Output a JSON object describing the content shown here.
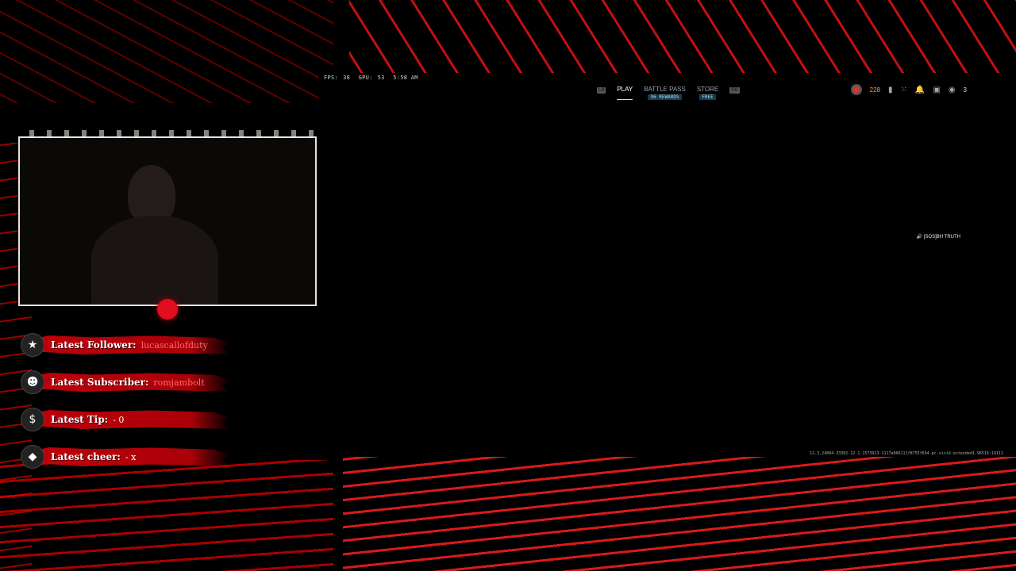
{
  "game": {
    "stats": {
      "fps_label": "FPS:",
      "fps_value": "38",
      "gpu_label": "GPU:",
      "gpu_value": "53",
      "time": "5:58 AM"
    },
    "nav": {
      "left_key": "LB",
      "right_key": "RB",
      "tabs": [
        {
          "label": "PLAY",
          "sub": ""
        },
        {
          "label": "BATTLE PASS",
          "sub": "96 REWARDS"
        },
        {
          "label": "STORE",
          "sub": "FREE"
        }
      ]
    },
    "hud": {
      "points": "228",
      "party_count": "3"
    },
    "voice_name": "[SOS]BH TRUTH",
    "version_string": "12.3.24004.33302-12.1.1573923-1117a006111f8755f694.pc.vivid.extended1.96516:19111"
  },
  "overlay": {
    "labels": [
      {
        "icon": "star-icon",
        "glyph": "★",
        "label": "Latest Follower:",
        "value": "lucascallofduty"
      },
      {
        "icon": "subscriber-icon",
        "glyph": "👤",
        "label": "Latest Subscriber:",
        "value": "romjambolt"
      },
      {
        "icon": "dollar-icon",
        "glyph": "$",
        "label": "Latest Tip:",
        "value": "- 0"
      },
      {
        "icon": "diamond-icon",
        "glyph": "◆",
        "label": "Latest cheer:",
        "value": "- x"
      }
    ]
  },
  "colors": {
    "accent_red": "#e20d1f",
    "points_orange": "#ff9b3d",
    "tab_sub": "#9fdcff"
  }
}
